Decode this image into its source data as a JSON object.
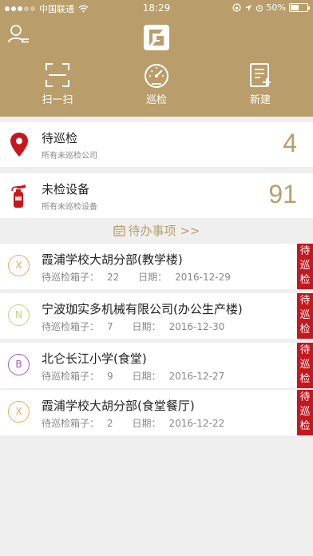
{
  "status_bar": {
    "carrier": "中国联通",
    "time": "18:29",
    "battery": "50%",
    "battery_level": 0.5
  },
  "header": {
    "actions": [
      {
        "label": "扫一扫",
        "icon": "scan-icon"
      },
      {
        "label": "巡检",
        "icon": "gauge-icon"
      },
      {
        "label": "新建",
        "icon": "new-document-icon"
      }
    ]
  },
  "stats": [
    {
      "title": "待巡检",
      "subtitle": "所有未巡检公司",
      "count": "4",
      "icon": "location-pin-icon"
    },
    {
      "title": "未检设备",
      "subtitle": "所有未巡检设备",
      "count": "91",
      "icon": "fire-extinguisher-icon"
    }
  ],
  "todo": {
    "title": "待办事项 >>",
    "items": [
      {
        "initial": "X",
        "color": "#f0a65a",
        "name": "霞浦学校大胡分部(教学楼)",
        "box_label": "待巡检箱子：",
        "box_count": "22",
        "date_label": "日期：",
        "date": "2016-12-29",
        "tag": "待巡检"
      },
      {
        "initial": "N",
        "color": "#bcd67a",
        "name": "宁波珈实多机械有限公司(办公生产楼)",
        "box_label": "待巡检箱子：",
        "box_count": "7",
        "date_label": "日期：",
        "date": "2016-12-30",
        "tag": "待巡检"
      },
      {
        "initial": "B",
        "color": "#a55bb4",
        "name": "北仑长江小学(食堂)",
        "box_label": "待巡检箱子：",
        "box_count": "9",
        "date_label": "日期：",
        "date": "2016-12-27",
        "tag": "待巡检"
      },
      {
        "initial": "X",
        "color": "#f0a65a",
        "name": "霞浦学校大胡分部(食堂餐厅)",
        "box_label": "待巡检箱子：",
        "box_count": "2",
        "date_label": "日期：",
        "date": "2016-12-22",
        "tag": "待巡检"
      }
    ]
  },
  "colors": {
    "header_bg": "#b99e6b",
    "accent": "#b99e6b",
    "tag_bg": "#c8161e",
    "page_bg": "#efefef"
  }
}
